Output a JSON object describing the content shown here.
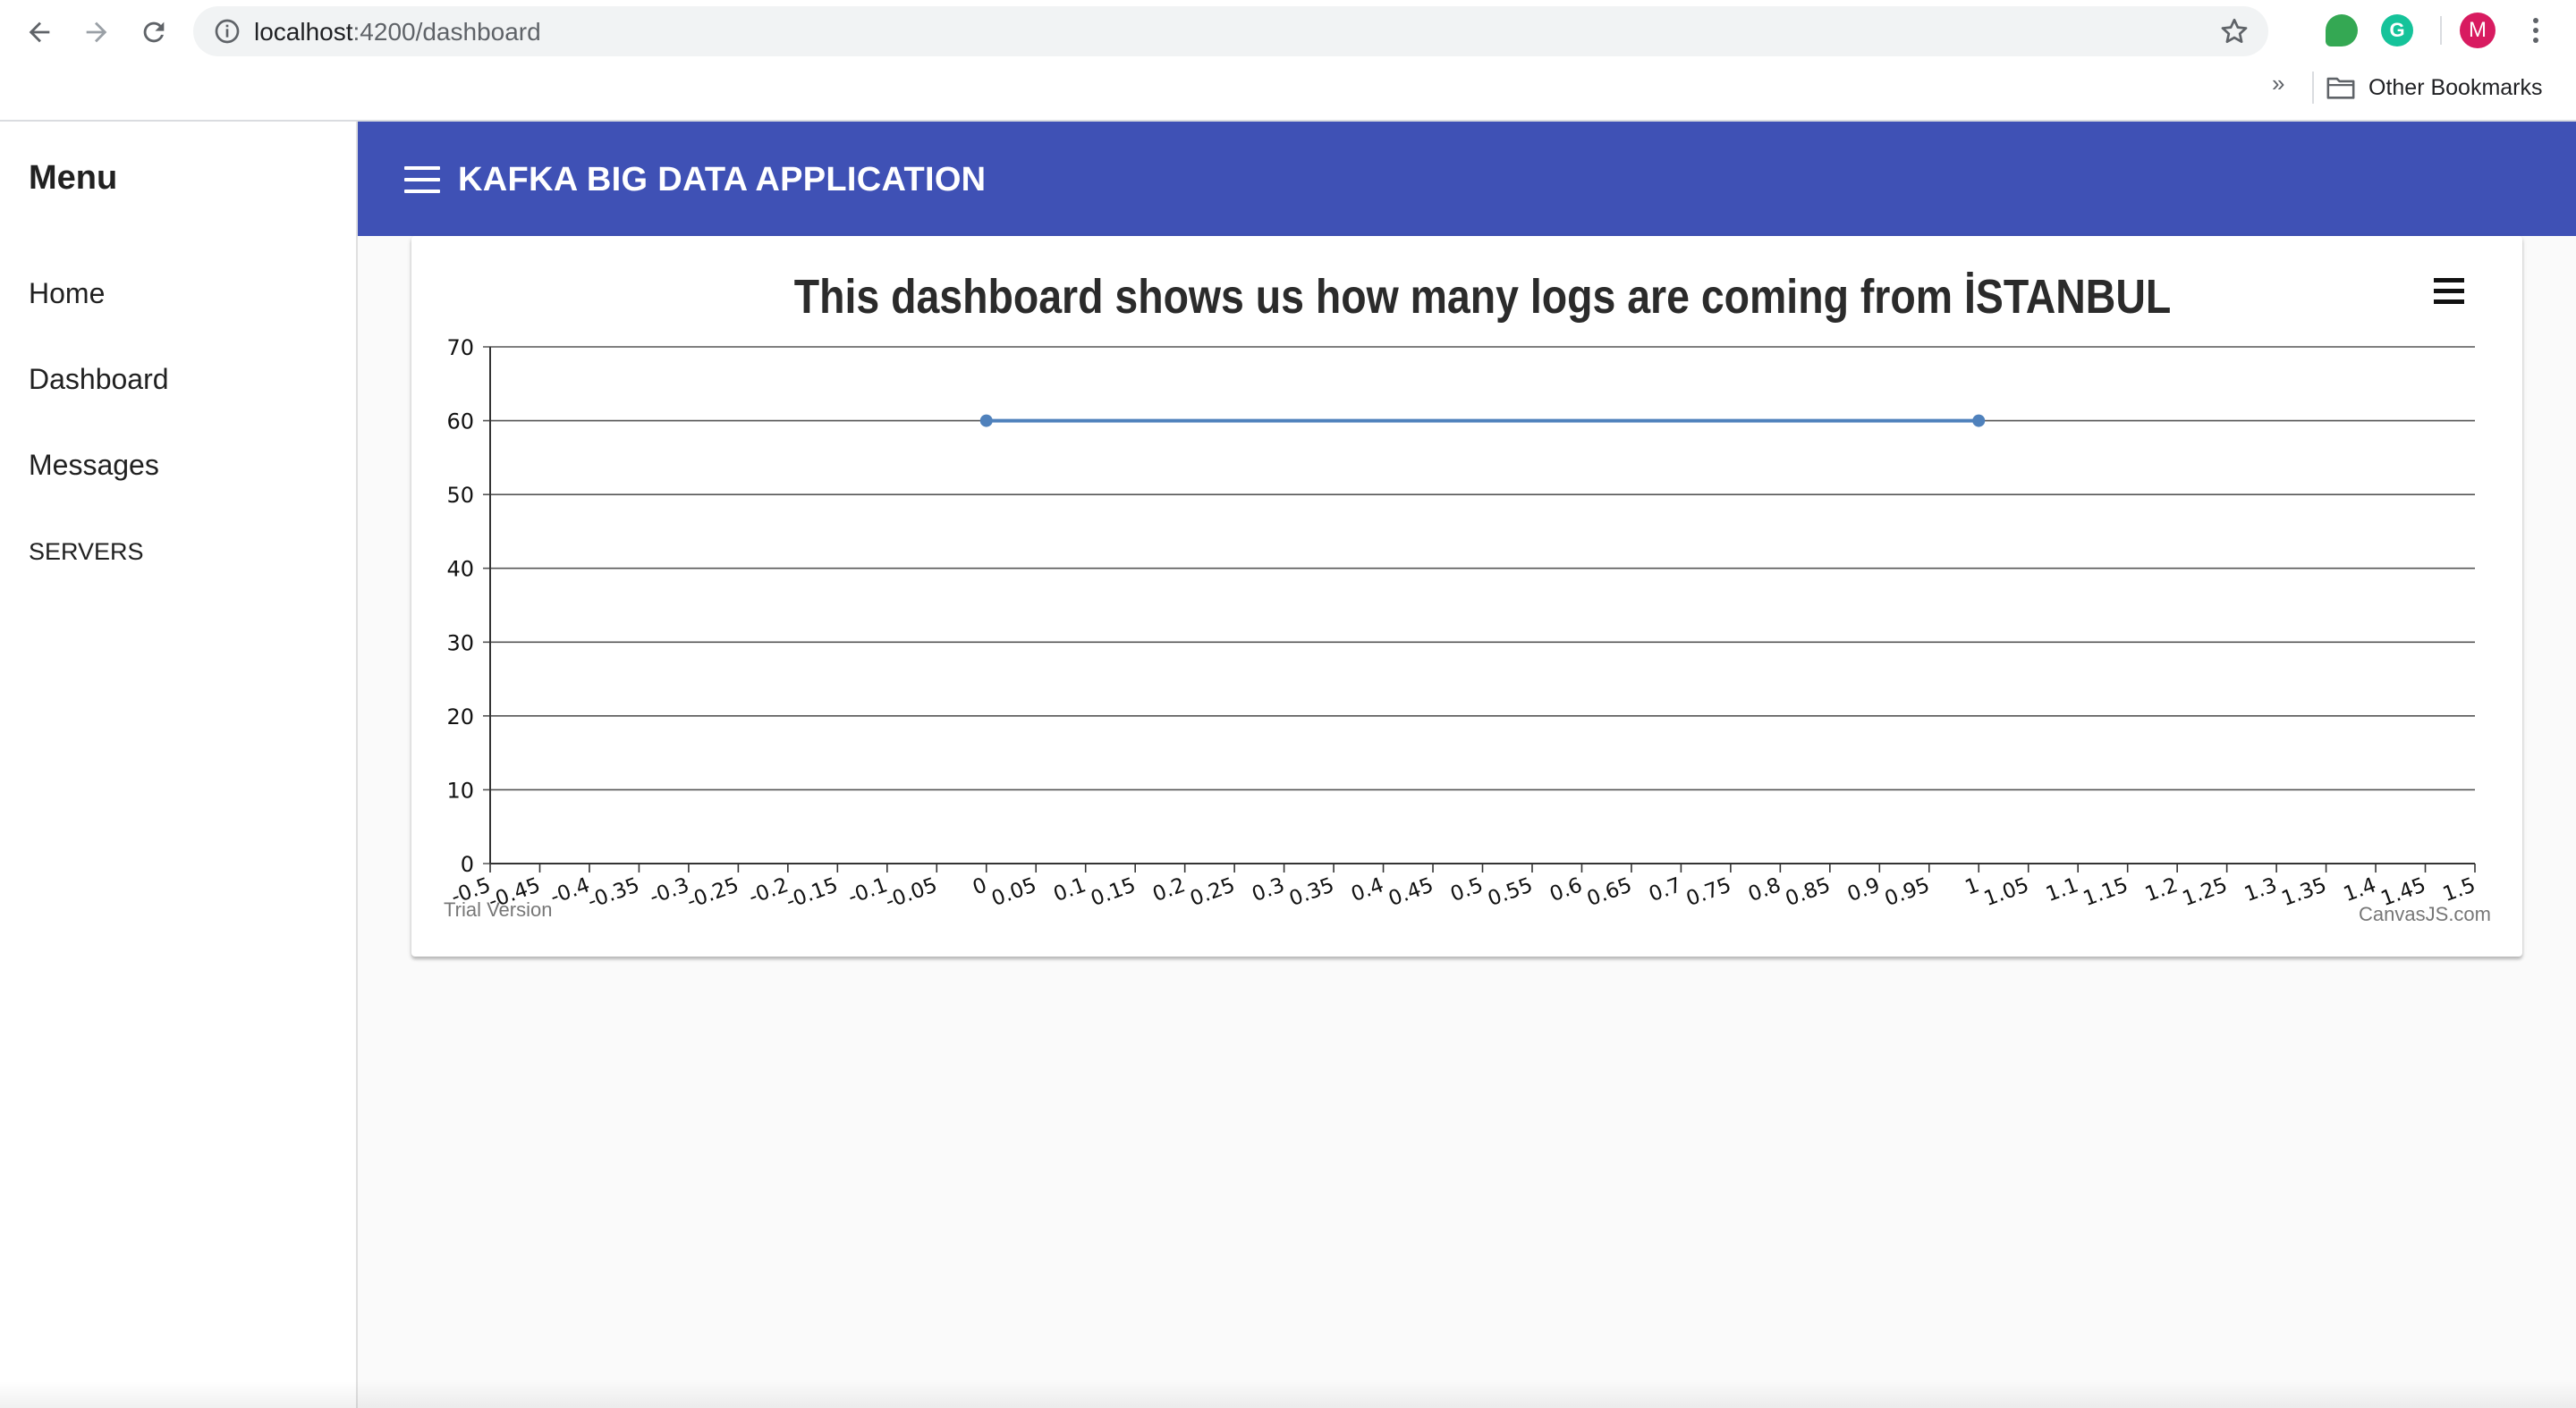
{
  "browser": {
    "url_host": "localhost",
    "url_path": ":4200/dashboard",
    "profile_initial": "M",
    "grammarly_label": "G",
    "bookmarks_more": "»",
    "bookmarks_folder": "Other Bookmarks"
  },
  "sidebar": {
    "title": "Menu",
    "items": [
      {
        "label": "Home"
      },
      {
        "label": "Dashboard"
      },
      {
        "label": "Messages"
      },
      {
        "label": "SERVERS"
      }
    ]
  },
  "toolbar": {
    "title": "KAFKA BIG DATA APPLICATION"
  },
  "chart_footer": {
    "left": "Trial Version",
    "right": "CanvasJS.com"
  },
  "chart_data": {
    "type": "line",
    "title": "This dashboard shows us how many logs are coming from İSTANBUL",
    "x": [
      0,
      1
    ],
    "values": [
      60,
      60
    ],
    "xlim": [
      -0.5,
      1.5
    ],
    "ylim": [
      0,
      70
    ],
    "x_ticks": [
      "-0.5",
      "-0.45",
      "-0.4",
      "-0.35",
      "-0.3",
      "-0.25",
      "-0.2",
      "-0.15",
      "-0.1",
      "-0.05",
      "0",
      "0.05",
      "0.1",
      "0.15",
      "0.2",
      "0.25",
      "0.3",
      "0.35",
      "0.4",
      "0.45",
      "0.5",
      "0.55",
      "0.6",
      "0.65",
      "0.7",
      "0.75",
      "0.8",
      "0.85",
      "0.9",
      "0.95",
      "1",
      "1.05",
      "1.1",
      "1.15",
      "1.2",
      "1.25",
      "1.3",
      "1.35",
      "1.4",
      "1.45",
      "1.5"
    ],
    "y_ticks": [
      "0",
      "10",
      "20",
      "30",
      "40",
      "50",
      "60",
      "70"
    ],
    "grid": true,
    "line_color": "#4f81bc",
    "grid_color": "#555555"
  }
}
